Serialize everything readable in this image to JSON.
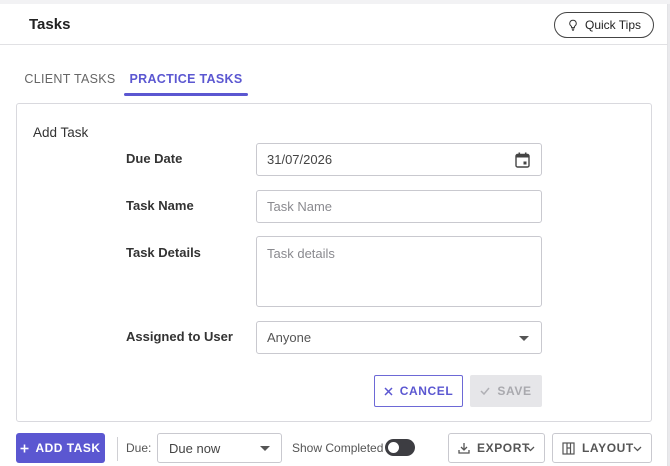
{
  "header": {
    "title": "Tasks",
    "quick_tips_label": "Quick Tips",
    "quick_tips_icon": "lightbulb-icon"
  },
  "tabs": [
    {
      "label": "CLIENT TASKS",
      "active": false
    },
    {
      "label": "PRACTICE TASKS",
      "active": true
    }
  ],
  "form": {
    "title": "Add Task",
    "due_date": {
      "label": "Due Date",
      "value": "31/07/2026",
      "icon": "calendar-icon"
    },
    "task_name": {
      "label": "Task Name",
      "placeholder": "Task Name",
      "value": ""
    },
    "task_details": {
      "label": "Task Details",
      "placeholder": "Task details",
      "value": ""
    },
    "assigned_user": {
      "label": "Assigned to User",
      "value": "Anyone"
    },
    "cancel_label": "CANCEL",
    "save_label": "SAVE"
  },
  "toolbar": {
    "add_task_label": "ADD TASK",
    "due_label": "Due:",
    "due_value": "Due now",
    "show_completed_label": "Show Completed",
    "show_completed": false,
    "export_label": "EXPORT",
    "layout_label": "LAYOUT"
  },
  "colors": {
    "accent": "#5b57d1",
    "toggle_off": "#3d3d42",
    "disabled_bg": "#e6e6e9"
  }
}
